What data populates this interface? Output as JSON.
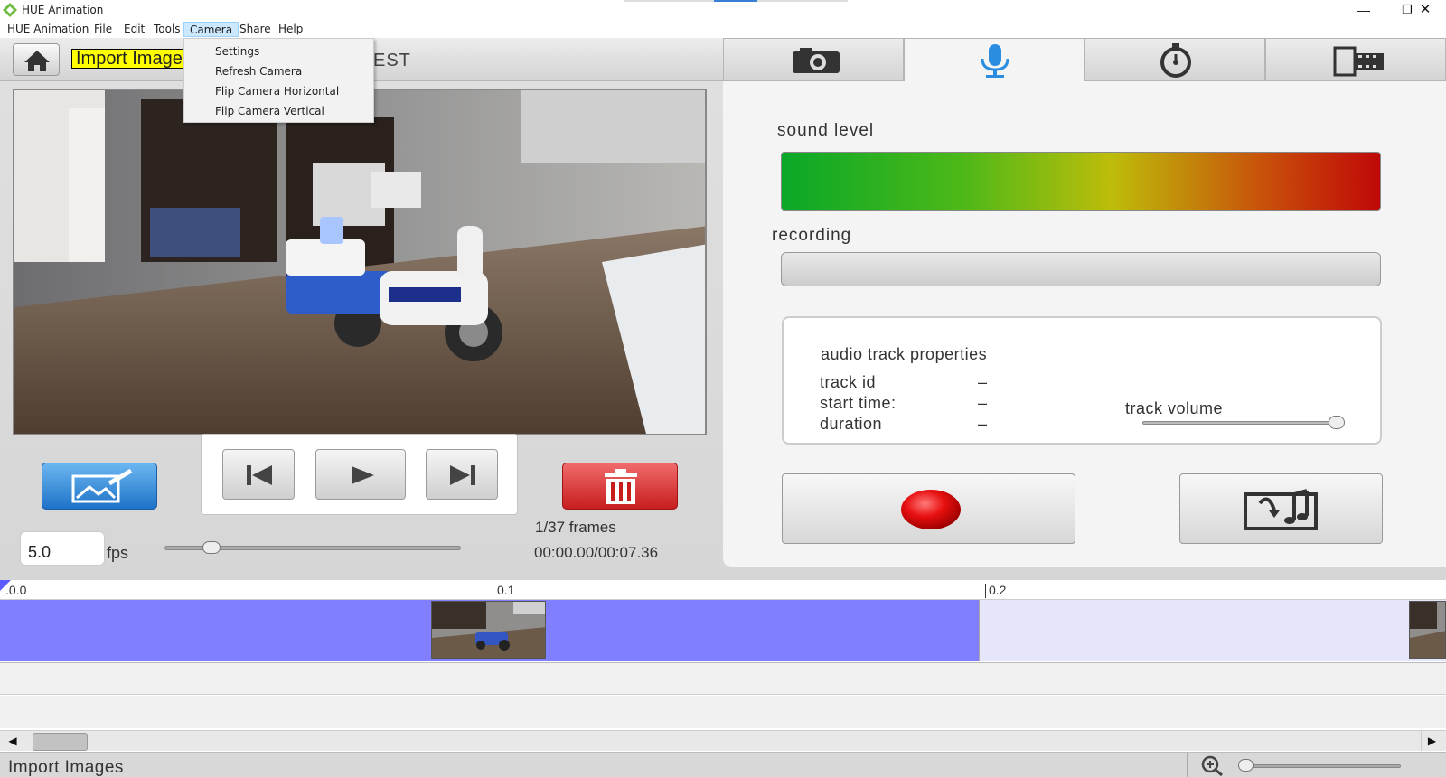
{
  "window": {
    "title": "HUE Animation",
    "minimize_glyph": "—",
    "restore_glyph": "❐",
    "close_glyph": "✕"
  },
  "menu": {
    "items": [
      "HUE Animation",
      "File",
      "Edit",
      "Tools",
      "Camera",
      "Share",
      "Help"
    ],
    "open_item": "Camera",
    "camera_dropdown": [
      "Settings",
      "Refresh Camera",
      "Flip Camera Horizontal",
      "Flip Camera Vertical"
    ]
  },
  "toolbar": {
    "import_label": "Import Images",
    "project_name_visible": "EST"
  },
  "playback": {
    "fps_value": "5.0",
    "fps_unit": "fps",
    "frames": "1/37 frames",
    "time": "00:00.00/00:07.36"
  },
  "audio": {
    "sound_level_label": "sound level",
    "recording_label": "recording",
    "properties_title": "audio track properties",
    "track_id_label": "track id",
    "track_id_value": "–",
    "start_time_label": "start time:",
    "start_time_value": "–",
    "duration_label": "duration",
    "duration_value": "–",
    "track_volume_label": "track volume"
  },
  "timeline": {
    "ticks": [
      ".0.0",
      "0.1",
      "0.2"
    ]
  },
  "statusbar": {
    "text": "Import Images"
  },
  "colors": {
    "menu_highlight": "#cce8ff",
    "timeline_track": "#7f7fff",
    "edit_button": "#1e73c9",
    "delete_button": "#c81e1e",
    "import_highlight": "#ffff00"
  },
  "icons": [
    "home-icon",
    "camera-icon",
    "microphone-icon",
    "stopwatch-icon",
    "film-icon",
    "edit-image-icon",
    "skip-back-icon",
    "play-icon",
    "skip-forward-icon",
    "trash-icon",
    "record-icon",
    "music-import-icon",
    "zoom-icon"
  ]
}
